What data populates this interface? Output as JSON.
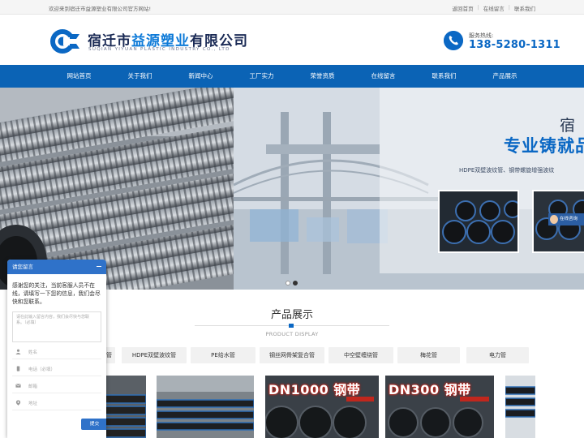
{
  "topbar": {
    "welcome": "欢迎来到宿迁市益源塑业有限公司官方网站!",
    "links": [
      "返回首页",
      "在线留言",
      "联系我们"
    ]
  },
  "header": {
    "company_prefix": "宿迁市",
    "company_accent": "益源塑业",
    "company_suffix": "有限公司",
    "company_en": "SUQIAN YIYUAN PLASTIC INDUSTRY CO., LTD",
    "hotline_label": "服务热线:",
    "hotline_number": "138-5280-1311",
    "brand_color": "#0b68c4"
  },
  "nav": {
    "items": [
      "网站首页",
      "关于我们",
      "新闻中心",
      "工厂实力",
      "荣誉资质",
      "在线留言",
      "联系我们",
      "产品展示"
    ]
  },
  "banner": {
    "slogan_char": "宿",
    "slogan": "专业铸就品",
    "subtitle": "HDPE双壁波纹管、钢带螺旋增强波纹",
    "dots": 2,
    "active_dot": 1
  },
  "products": {
    "title": "产品展示",
    "subtitle": "PRODUCT DISPLAY",
    "categories": [
      "管",
      "HDPE双壁波纹管",
      "PE给水管",
      "钢丝网骨架复合管",
      "中空壁缠绕管",
      "梅花管",
      "电力管"
    ],
    "photos": [
      {
        "text": ""
      },
      {
        "text": ""
      },
      {
        "text": "DN1000 钢带"
      },
      {
        "text": "DN300 钢带"
      },
      {
        "text": ""
      }
    ]
  },
  "chat": {
    "title": "请您留言",
    "message": "感谢您的关注，当前客服人员不在线，请填写一下您的信息，我们会尽快和您联系。",
    "textarea_placeholder": "请在此输入留言内容，我们会尽快与您联系。（必填）",
    "fields": [
      {
        "label": "姓名",
        "icon": "user-icon"
      },
      {
        "label": "电话（必填）",
        "icon": "phone-icon"
      },
      {
        "label": "邮箱",
        "icon": "mail-icon"
      },
      {
        "label": "地址",
        "icon": "location-icon"
      }
    ],
    "submit": "提交"
  },
  "float_chip": {
    "label": "在线咨询"
  }
}
